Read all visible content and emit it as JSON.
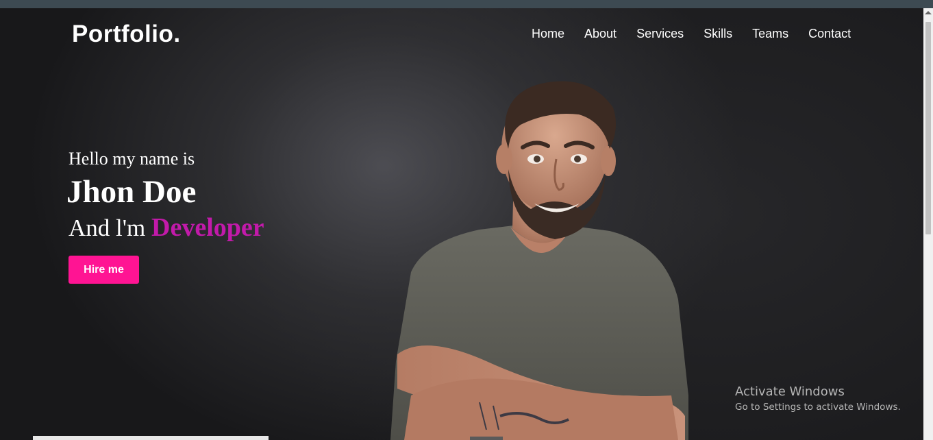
{
  "header": {
    "logo": "Portfolio.",
    "nav": [
      "Home",
      "About",
      "Services",
      "Skills",
      "Teams",
      "Contact"
    ]
  },
  "hero": {
    "greeting": "Hello my name is",
    "name": "Jhon Doe",
    "role_prefix": "And l'm",
    "role": "Developer",
    "cta_label": "Hire me"
  },
  "overlay": {
    "title": "Activate Windows",
    "subtitle": "Go to Settings to activate Windows."
  },
  "colors": {
    "accent": "#ff1493",
    "role_text": "#c21aaa",
    "background": "#1b1b1d"
  },
  "icons": {
    "hero_image": "man-portrait-photo"
  }
}
